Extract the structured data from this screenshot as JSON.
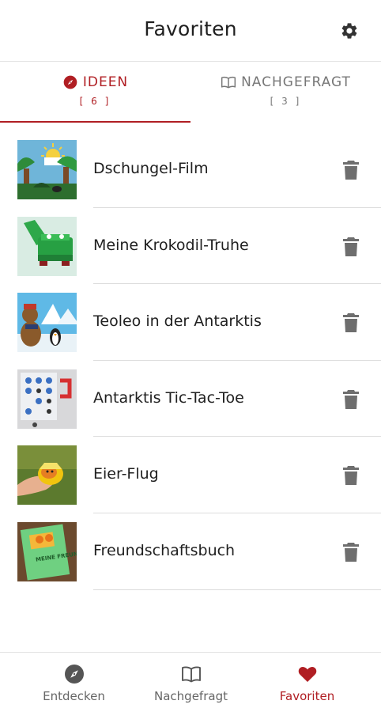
{
  "header": {
    "title": "Favoriten",
    "settings_icon": "gear-icon"
  },
  "tabs": [
    {
      "label": "IDEEN",
      "count": "[ 6 ]",
      "icon": "compass-icon",
      "active": true
    },
    {
      "label": "NACHGEFRAGT",
      "count": "[ 3 ]",
      "icon": "open-book-icon",
      "active": false
    }
  ],
  "favorites": [
    {
      "title": "Dschungel-Film",
      "action_icon": "trash-icon"
    },
    {
      "title": "Meine Krokodil-Truhe",
      "action_icon": "trash-icon"
    },
    {
      "title": "Teoleo in der Antarktis",
      "action_icon": "trash-icon"
    },
    {
      "title": "Antarktis Tic-Tac-Toe",
      "action_icon": "trash-icon"
    },
    {
      "title": "Eier-Flug",
      "action_icon": "trash-icon"
    },
    {
      "title": "Freundschaftsbuch",
      "action_icon": "trash-icon"
    }
  ],
  "thumbnail_text": {
    "book_cover": "MEINE FREUNDE"
  },
  "bottom_nav": [
    {
      "label": "Entdecken",
      "icon": "compass-icon",
      "active": false
    },
    {
      "label": "Nachgefragt",
      "icon": "open-book-icon",
      "active": false
    },
    {
      "label": "Favoriten",
      "icon": "heart-icon",
      "active": true
    }
  ],
  "colors": {
    "accent": "#b01e23",
    "inactive": "#666666",
    "icon_grey": "#6e6e6e",
    "divider": "#dcdcdc"
  }
}
